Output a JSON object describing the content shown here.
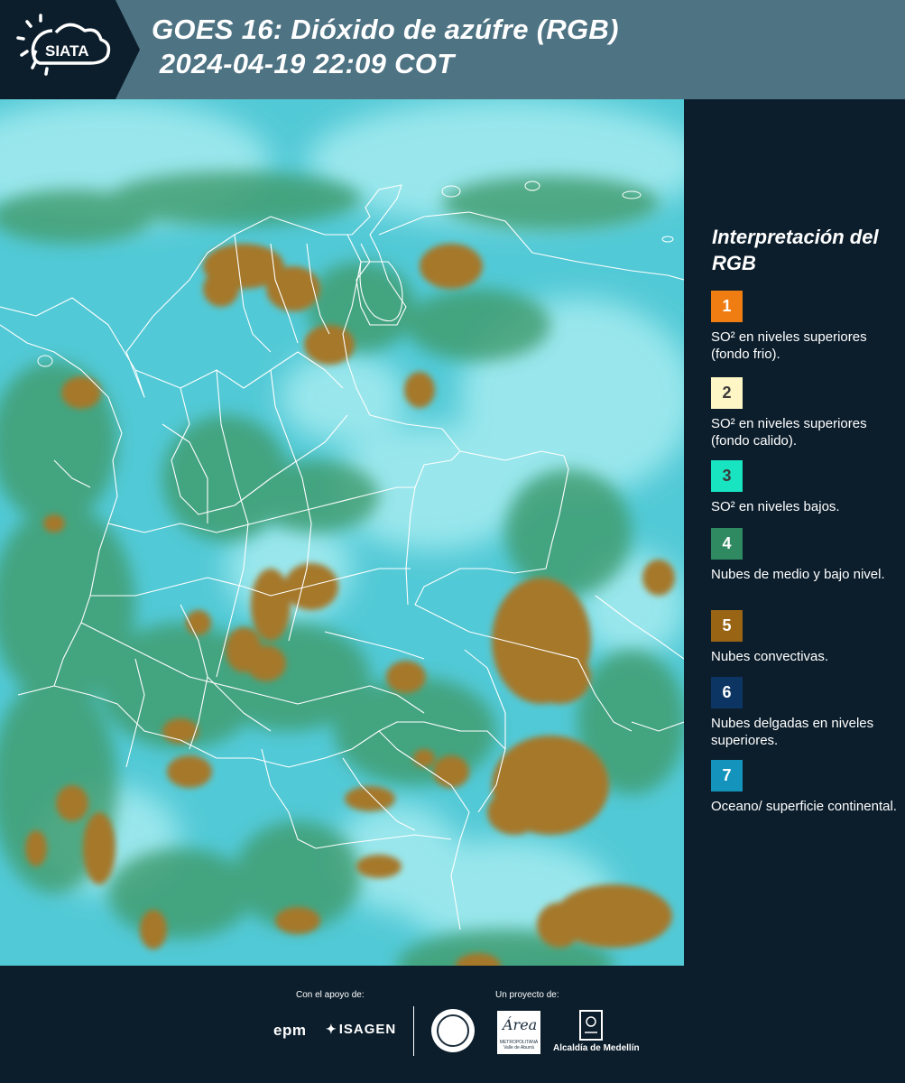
{
  "header": {
    "logo_text": "SIATA",
    "title_line1": "GOES 16: Dióxido de azúfre (RGB)",
    "title_line2": " 2024-04-19 22:09 COT",
    "background_color": "#4e7383"
  },
  "legend": {
    "title": "Interpretación del RGB",
    "items": [
      {
        "number": "1",
        "color": "#f07d12",
        "text": "SO² en niveles superiores (fondo frio)."
      },
      {
        "number": "2",
        "color": "#fff6c5",
        "text": "SO² en niveles superiores (fondo calido)."
      },
      {
        "number": "3",
        "color": "#19e4c2",
        "text": "SO² en niveles bajos."
      },
      {
        "number": "4",
        "color": "#2f8a62",
        "text": "Nubes de medio y bajo nivel."
      },
      {
        "number": "5",
        "color": "#996515",
        "text": "Nubes convectivas."
      },
      {
        "number": "6",
        "color": "#0d3564",
        "text": "Nubes delgadas en niveles superiores."
      },
      {
        "number": "7",
        "color": "#1494bc",
        "text": "Oceano/ superficie continental."
      }
    ]
  },
  "footer": {
    "support_label": "Con el apoyo de:",
    "project_label": "Un proyecto de:",
    "epm": "epm",
    "isagen": "ISAGEN",
    "area_logo_text": "Área",
    "area_logo_sub": "METROPOLITANA Valle de Aburrá",
    "alcaldia": "Alcaldía de Medellín"
  },
  "map": {
    "palette": {
      "background": "#52c9d6",
      "high_cloud": "#a6ecf0",
      "green_cloud": "#3f9c6e",
      "convective": "#a5782a",
      "borders": "#ffffff"
    }
  }
}
